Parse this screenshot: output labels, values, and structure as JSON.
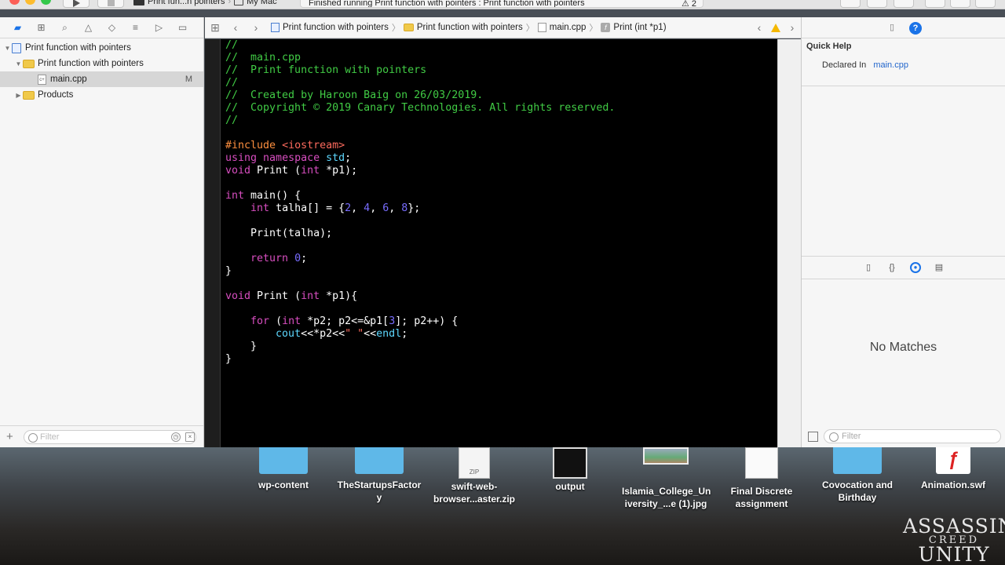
{
  "toolbar": {
    "scheme": "Print fun...n pointers",
    "destination": "My Mac",
    "activity_status": "Finished running Print function with pointers : Print function with pointers",
    "warning_count": "2"
  },
  "navigator": {
    "project": "Print function with pointers",
    "group": "Print function with pointers",
    "file": "main.cpp",
    "file_badge": "M",
    "products": "Products",
    "filter_placeholder": "Filter"
  },
  "jumpbar": {
    "crumbs": [
      "Print function with pointers",
      "Print function with pointers",
      "main.cpp",
      "Print (int *p1)"
    ]
  },
  "code": {
    "language": "C++",
    "lines": [
      "//",
      "//  main.cpp",
      "//  Print function with pointers",
      "//",
      "//  Created by Haroon Baig on 26/03/2019.",
      "//  Copyright © 2019 Canary Technologies. All rights reserved.",
      "//",
      "",
      "#include <iostream>",
      "using namespace std;",
      "void Print (int *p1);",
      "",
      "int main() {",
      "    int talha[] = {2, 4, 6, 8};",
      "",
      "    Print(talha);",
      "",
      "    return 0;",
      "}",
      "",
      "void Print (int *p1){",
      "",
      "    for (int *p2; p2<=&p1[3]; p2++) {",
      "        cout<<*p2<<\" \"<<endl;",
      "    }",
      "}"
    ]
  },
  "inspector": {
    "title": "Quick Help",
    "declared_in_label": "Declared In",
    "declared_in_value": "main.cpp",
    "no_matches": "No Matches",
    "filter_placeholder": "Filter"
  },
  "desktop": {
    "items": [
      {
        "label_1": "wp-content",
        "label_2": "",
        "kind": "folder"
      },
      {
        "label_1": "TheStartupsFactor",
        "label_2": "y",
        "kind": "folder"
      },
      {
        "label_1": "swift-web-",
        "label_2": "browser...aster.zip",
        "kind": "zip",
        "thumb_text": "ZIP"
      },
      {
        "label_1": "output",
        "label_2": "",
        "kind": "video"
      },
      {
        "label_1": "Islamia_College_Un",
        "label_2": "iversity_...e (1).jpg",
        "kind": "photo"
      },
      {
        "label_1": "Final Discrete",
        "label_2": "assignment",
        "kind": "document"
      },
      {
        "label_1": "Covocation and",
        "label_2": "Birthday",
        "kind": "folder"
      },
      {
        "label_1": "Animation.swf",
        "label_2": "",
        "kind": "swf"
      }
    ],
    "wallpaper_text_1": "ASSASSIN",
    "wallpaper_text_2": "CREED",
    "wallpaper_text_3": "UNITY"
  },
  "colors": {
    "comment": "#41cc45",
    "keyword": "#d84ec0",
    "preprocessor": "#fd8f3f",
    "string": "#fc6a5d",
    "number": "#786dff",
    "type": "#5dd8ff",
    "editor_bg": "#000000",
    "accent": "#1a73e8"
  }
}
